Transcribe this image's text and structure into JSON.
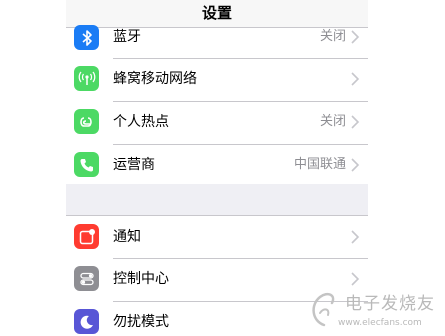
{
  "navbar": {
    "title": "设置"
  },
  "group1": [
    {
      "label": "蓝牙",
      "value": "关闭",
      "icon": "bluetooth-icon",
      "color": "#1a7cf5"
    },
    {
      "label": "蜂窝移动网络",
      "value": "",
      "icon": "cellular-icon",
      "color": "#4cd964"
    },
    {
      "label": "个人热点",
      "value": "关闭",
      "icon": "hotspot-icon",
      "color": "#4cd964"
    },
    {
      "label": "运营商",
      "value": "中国联通",
      "icon": "phone-icon",
      "color": "#4cd964"
    }
  ],
  "group2": [
    {
      "label": "通知",
      "value": "",
      "icon": "notifications-icon",
      "color": "#ff3b30"
    },
    {
      "label": "控制中心",
      "value": "",
      "icon": "control-center-icon",
      "color": "#8e8e93"
    },
    {
      "label": "勿扰模式",
      "value": "",
      "icon": "moon-icon",
      "color": "#5856d6"
    }
  ],
  "watermark": {
    "text": "电子发烧友",
    "url": "www.elecfans.com"
  }
}
